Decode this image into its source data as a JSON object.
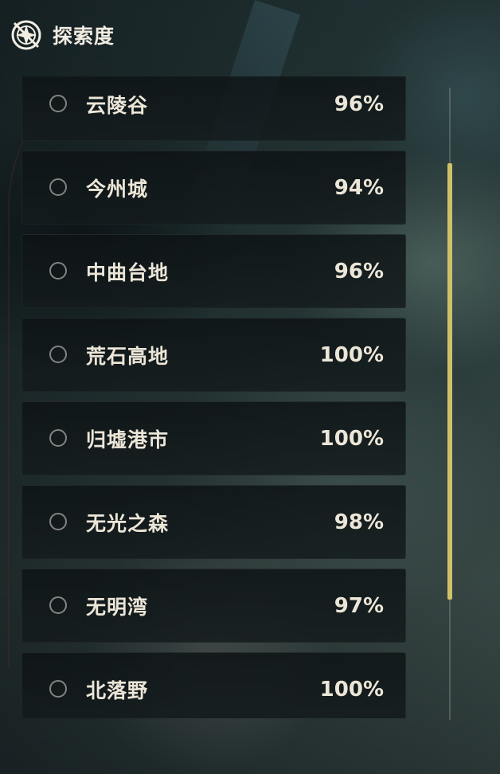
{
  "header": {
    "title": "探索度",
    "icon": "compass-icon"
  },
  "colors": {
    "accent": "#cfc06a",
    "text": "#ece6d8",
    "row_bg": "#121a1c"
  },
  "regions": [
    {
      "name": "云陵谷",
      "percent": "96%"
    },
    {
      "name": "今州城",
      "percent": "94%"
    },
    {
      "name": "中曲台地",
      "percent": "96%"
    },
    {
      "name": "荒石高地",
      "percent": "100%"
    },
    {
      "name": "归墟港市",
      "percent": "100%"
    },
    {
      "name": "无光之森",
      "percent": "98%"
    },
    {
      "name": "无明湾",
      "percent": "97%"
    },
    {
      "name": "北落野",
      "percent": "100%"
    }
  ],
  "scroll": {
    "position_fraction": 0.12,
    "visible_fraction": 0.69
  }
}
